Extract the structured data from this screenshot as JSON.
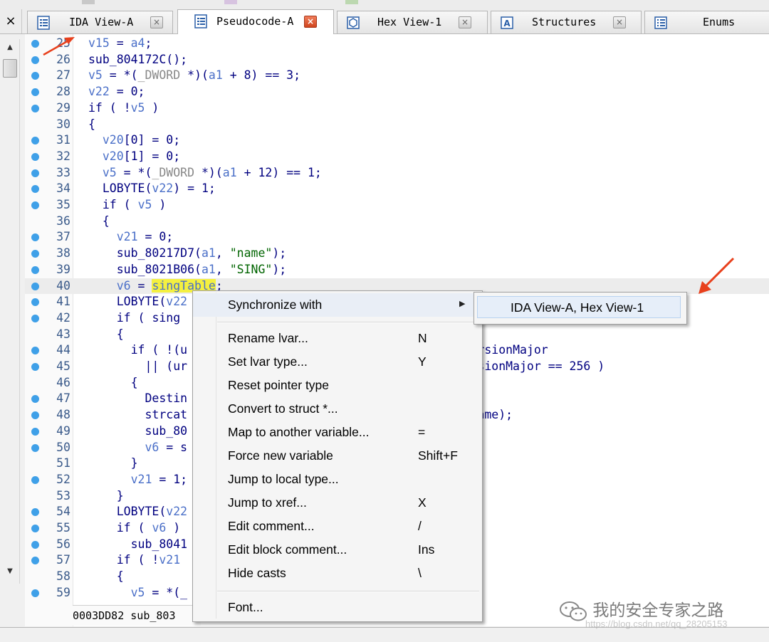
{
  "tabs": [
    {
      "label": "IDA View-A",
      "icon": "ida-view-icon",
      "active": false
    },
    {
      "label": "Pseudocode-A",
      "icon": "pseudocode-icon",
      "active": true
    },
    {
      "label": "Hex View-1",
      "icon": "hex-view-icon",
      "active": false
    },
    {
      "label": "Structures",
      "icon": "structures-icon",
      "active": false
    },
    {
      "label": "Enums",
      "icon": "enums-icon",
      "active": false
    }
  ],
  "close_glyph": "×",
  "lines": [
    {
      "n": "25",
      "code": "v15 = a4;"
    },
    {
      "n": "26",
      "code": "sub_804172C();"
    },
    {
      "n": "27",
      "code": "v5 = *(_DWORD *)(a1 + 8) == 3;"
    },
    {
      "n": "28",
      "code": "v22 = 0;"
    },
    {
      "n": "29",
      "code": "if ( !v5 )"
    },
    {
      "n": "30",
      "code": "{"
    },
    {
      "n": "31",
      "code": "  v20[0] = 0;"
    },
    {
      "n": "32",
      "code": "  v20[1] = 0;"
    },
    {
      "n": "33",
      "code": "  v5 = *(_DWORD *)(a1 + 12) == 1;"
    },
    {
      "n": "34",
      "code": "  LOBYTE(v22) = 1;"
    },
    {
      "n": "35",
      "code": "  if ( v5 )"
    },
    {
      "n": "36",
      "code": "  {"
    },
    {
      "n": "37",
      "code": "    v21 = 0;"
    },
    {
      "n": "38",
      "code": "    sub_80217D7(a1, \"name\");"
    },
    {
      "n": "39",
      "code": "    sub_8021B06(a1, \"SING\");"
    },
    {
      "n": "40",
      "code": "    v6 = singTable;"
    },
    {
      "n": "41",
      "code": "    LOBYTE(v22"
    },
    {
      "n": "42",
      "code": "    if ( sing"
    },
    {
      "n": "43",
      "code": "    {"
    },
    {
      "n": "44",
      "code": "      if ( !(u                                 >tableVersionMajor"
    },
    {
      "n": "45",
      "code": "        || (ur                                 tableVersionMajor == 256 )"
    },
    {
      "n": "46",
      "code": "      {"
    },
    {
      "n": "47",
      "code": "        Destin"
    },
    {
      "n": "48",
      "code": "        strcat                                 >uniqueName);"
    },
    {
      "n": "49",
      "code": "        sub_80"
    },
    {
      "n": "50",
      "code": "        v6 = s"
    },
    {
      "n": "51",
      "code": "      }"
    },
    {
      "n": "52",
      "code": "      v21 = 1;"
    },
    {
      "n": "53",
      "code": "    }"
    },
    {
      "n": "54",
      "code": "    LOBYTE(v22"
    },
    {
      "n": "55",
      "code": "    if ( v6 )"
    },
    {
      "n": "56",
      "code": "      sub_8041"
    },
    {
      "n": "57",
      "code": "    if ( !v21"
    },
    {
      "n": "58",
      "code": "    {"
    },
    {
      "n": "59",
      "code": "      v5 = *(_"
    }
  ],
  "status": {
    "address": "0003DD82",
    "func": "sub_803"
  },
  "context_menu": {
    "items": [
      {
        "label": "Synchronize with",
        "key": "",
        "submenu": true
      },
      {
        "label": "Rename lvar...",
        "key": "N"
      },
      {
        "label": "Set lvar type...",
        "key": "Y"
      },
      {
        "label": "Reset pointer type",
        "key": ""
      },
      {
        "label": "Convert to struct *...",
        "key": ""
      },
      {
        "label": "Map to another variable...",
        "key": "="
      },
      {
        "label": "Force new variable",
        "key": "Shift+F"
      },
      {
        "label": "Jump to local type...",
        "key": ""
      },
      {
        "label": "Jump to xref...",
        "key": "X"
      },
      {
        "label": "Edit comment...",
        "key": "/"
      },
      {
        "label": "Edit block comment...",
        "key": "Ins"
      },
      {
        "label": "Hide casts",
        "key": "\\"
      },
      {
        "label": "Font...",
        "key": ""
      }
    ],
    "submenu_item": "IDA View-A, Hex View-1"
  },
  "watermark": {
    "text": "我的安全专家之路",
    "url": "https://blog.csdn.net/qq_28205153"
  },
  "colors": {
    "accent_red": "#e8401c",
    "dot_blue": "#3fa0e8",
    "highlight_yellow": "#f4f040"
  }
}
